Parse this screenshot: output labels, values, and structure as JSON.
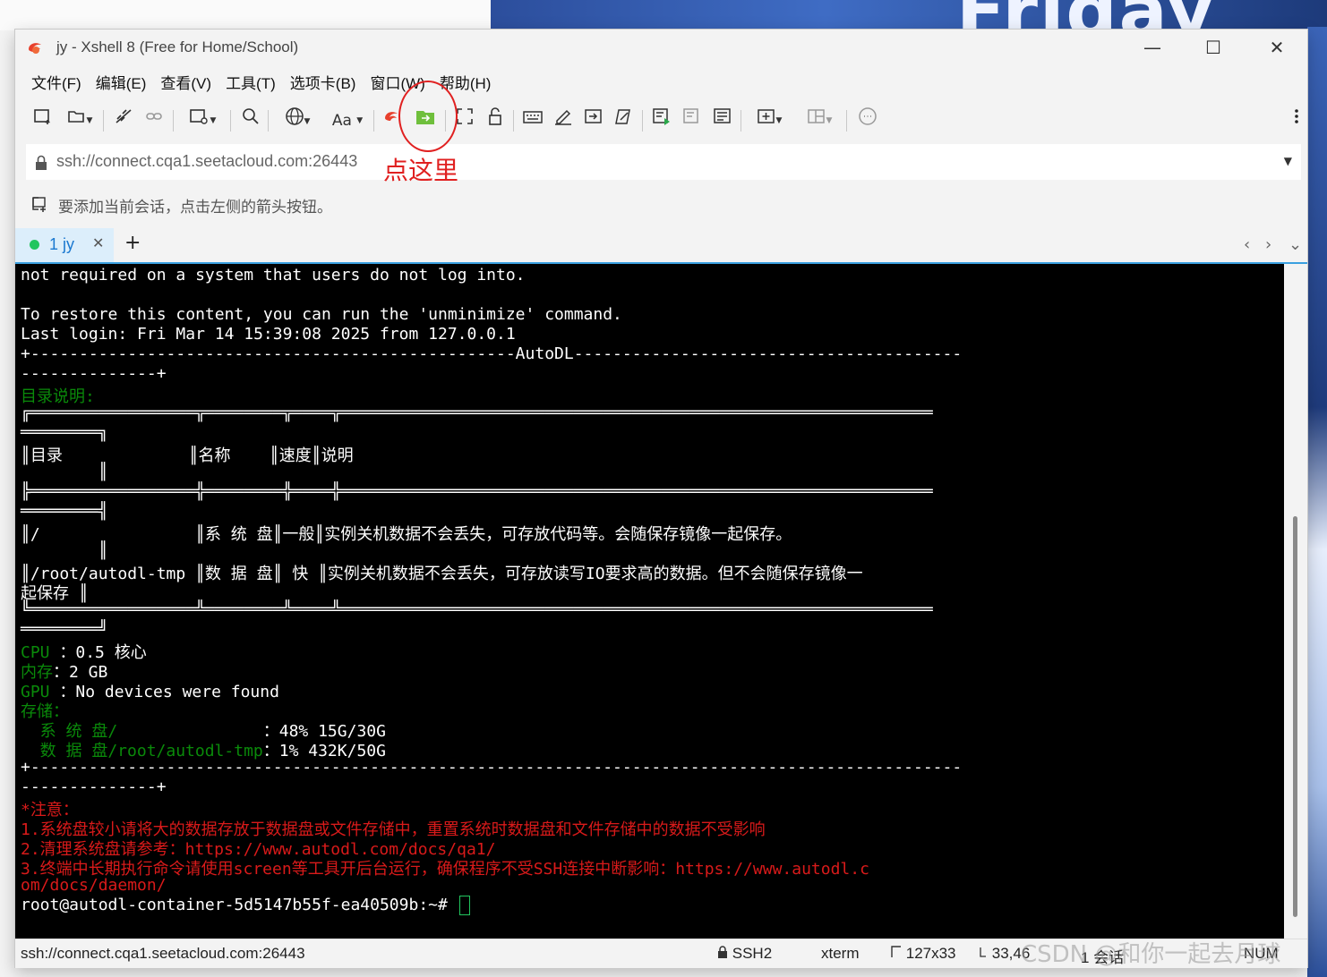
{
  "window": {
    "title": "jy - Xshell 8 (Free for Home/School)",
    "controls": [
      "—",
      "☐",
      "✕"
    ]
  },
  "menu": [
    "文件(F)",
    "编辑(E)",
    "查看(V)",
    "工具(T)",
    "选项卡(B)",
    "窗口(W)",
    "帮助(H)"
  ],
  "toolbar": {
    "font_label": "Aa"
  },
  "address": {
    "value": "ssh://connect.cqa1.seetacloud.com:26443"
  },
  "annotation": {
    "text": "点这里"
  },
  "hint": {
    "text": "要添加当前会话，点击左侧的箭头按钮。"
  },
  "tabs": [
    {
      "label": "1 jy",
      "status_color": "#22c55e"
    }
  ],
  "tab_add": "+",
  "terminal": {
    "lines": [
      "not required on a system that users do not log into.",
      "",
      "To restore this content, you can run the 'unminimize' command.",
      "Last login: Fri Mar 14 15:39:08 2025 from 127.0.0.1",
      "+--------------------------------------------------AutoDL----------------------------------------",
      "--------------+",
      "目录说明:",
      "╔═════════════════╦════════╦════╦═════════════════════════════════════════════════════════════",
      "════════╗",
      "║目录             ║名称    ║速度║说明",
      "        ║",
      "╠═════════════════╬════════╬════╬═════════════════════════════════════════════════════════════",
      "════════╣",
      "║/                ║系 统 盘║一般║实例关机数据不会丢失，可存放代码等。会随保存镜像一起保存。",
      "        ║",
      "║/root/autodl-tmp ║数 据 盘║ 快 ║实例关机数据不会丢失，可存放读写IO要求高的数据。但不会随保存镜像一",
      "起保存 ║",
      "╚═════════════════╩════════╩════╩═════════════════════════════════════════════════════════════",
      "════════╝",
      "CPU ：0.5 核心",
      "内存：2 GB",
      "GPU ：No devices were found",
      "存储：",
      "  系 统 盘/               ：48% 15G/30G",
      "  数 据 盘/root/autodl-tmp：1% 432K/50G",
      "+------------------------------------------------------------------------------------------------",
      "--------------+",
      "*注意：",
      "1.系统盘较小请将大的数据存放于数据盘或文件存储中，重置系统时数据盘和文件存储中的数据不受影响",
      "2.清理系统盘请参考：https://www.autodl.com/docs/qa1/",
      "3.终端中长期执行命令请使用screen等工具开后台运行，确保程序不受SSH连接中断影响：https://www.autodl.c",
      "om/docs/daemon/",
      "root@autodl-container-5d5147b55f-ea40509b:~# "
    ],
    "line_colors": [
      "w",
      "w",
      "w",
      "w",
      "w",
      "w",
      "g",
      "w",
      "w",
      "w",
      "w",
      "w",
      "w",
      "w",
      "w",
      "w",
      "w",
      "w",
      "w",
      "mix",
      "mix",
      "mix",
      "g",
      "mix",
      "mix",
      "w",
      "w",
      "r",
      "r",
      "r",
      "r",
      "r",
      "w"
    ]
  },
  "status": {
    "address": "ssh://connect.cqa1.seetacloud.com:26443",
    "protocol": "SSH2",
    "term": "xterm",
    "size": "127x33",
    "cursor_pos": "33,46",
    "sessions": "1 会话",
    "num": "NUM"
  },
  "watermark": "CSDN @和你一起去月球",
  "colors": {
    "accent": "#3aa0e0",
    "annotation": "#e02020",
    "term_green": "#0a8a0a",
    "term_red": "#d91a1a"
  }
}
